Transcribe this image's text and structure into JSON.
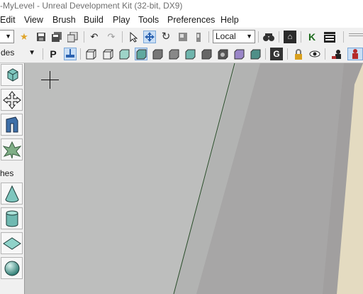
{
  "window": {
    "title": "-MyLevel - Unreal Development Kit (32-bit, DX9)"
  },
  "menu": [
    "Edit",
    "View",
    "Brush",
    "Build",
    "Play",
    "Tools",
    "Preferences",
    "Help"
  ],
  "toolbar1": {
    "coord_system": "Local",
    "icons": [
      "dropdown-arrow-icon",
      "favorite-star-icon",
      "save-icon",
      "save-all-icon",
      "copy-icon",
      "undo-icon",
      "redo-icon",
      "select-cursor-icon",
      "translate-icon",
      "rotate-icon",
      "scale-icon",
      "scale-nonuniform-icon",
      "find-icon",
      "kismet-icon",
      "k-icon",
      "matinee-icon"
    ]
  },
  "toolbar2": {
    "mode_label": "des",
    "icons": [
      "p-icon",
      "pivot-icon",
      "wireframe-icon",
      "brush-wireframe-icon",
      "unlit-icon",
      "lit-icon",
      "detail-lighting-icon",
      "lighting-only-icon",
      "light-complexity-icon",
      "texture-density-icon",
      "shader-complexity-icon",
      "lightmap-density-icon",
      "reflection-icon",
      "g-icon",
      "lock-icon",
      "eye-icon",
      "actor-icon",
      "person-icon"
    ]
  },
  "leftbar": {
    "section_label": "hes",
    "tools": [
      "camera-mode-icon",
      "geometry-mode-icon",
      "terrain-mode-icon",
      "foliage-mode-icon"
    ],
    "brushes": [
      "cone-brush-icon",
      "cylinder-brush-icon",
      "sheet-brush-icon",
      "sphere-brush-icon"
    ]
  },
  "colors": {
    "viewport_light": "#bcbdbc",
    "viewport_dark": "#a6a5a5",
    "wall_beige": "#e5dcc2"
  }
}
